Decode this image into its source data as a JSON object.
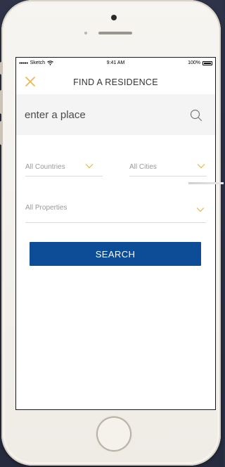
{
  "status_bar": {
    "carrier": "Sketch",
    "signal_dots": "●●●●●",
    "time": "9:41 AM",
    "battery_text": "100%",
    "battery_level": 1.0
  },
  "nav": {
    "title": "FIND A RESIDENCE",
    "close_icon": "close-x-icon"
  },
  "search": {
    "placeholder": "enter a place",
    "icon": "search-icon"
  },
  "filters": {
    "country": {
      "label": "All Countries",
      "icon": "chevron-down-icon"
    },
    "city": {
      "label": "All Cities",
      "icon": "chevron-down-icon"
    },
    "property": {
      "label": "All Properties",
      "icon": "chevron-down-icon"
    }
  },
  "actions": {
    "search_label": "SEARCH"
  },
  "colors": {
    "accent_gold": "#e8b84a",
    "primary_button": "#0d4d97",
    "search_bar_bg": "#f4f4f4"
  }
}
